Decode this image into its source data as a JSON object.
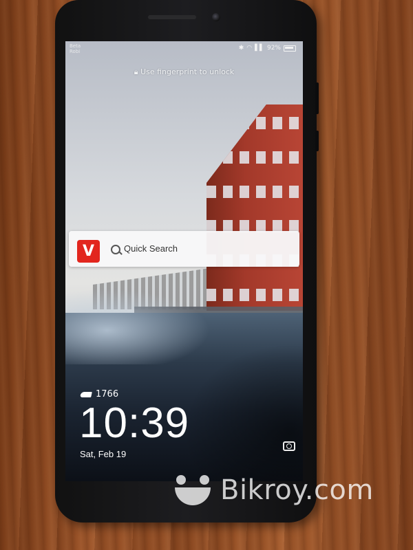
{
  "status_bar": {
    "carrier_line1": "Beta",
    "carrier_line2": "Robi",
    "icons": [
      "bluetooth-icon",
      "wifi-icon",
      "signal-icon",
      "battery-icon"
    ],
    "battery": "92%"
  },
  "lock_screen": {
    "fingerprint_hint": "Use fingerprint to unlock",
    "quick_search": {
      "app_logo_letter": "V",
      "logo_color": "#e2261e",
      "placeholder": "Quick Search"
    },
    "steps": "1766",
    "time": "10:39",
    "date": "Sat, Feb 19"
  },
  "watermark": {
    "text": "Bikroy.com"
  }
}
